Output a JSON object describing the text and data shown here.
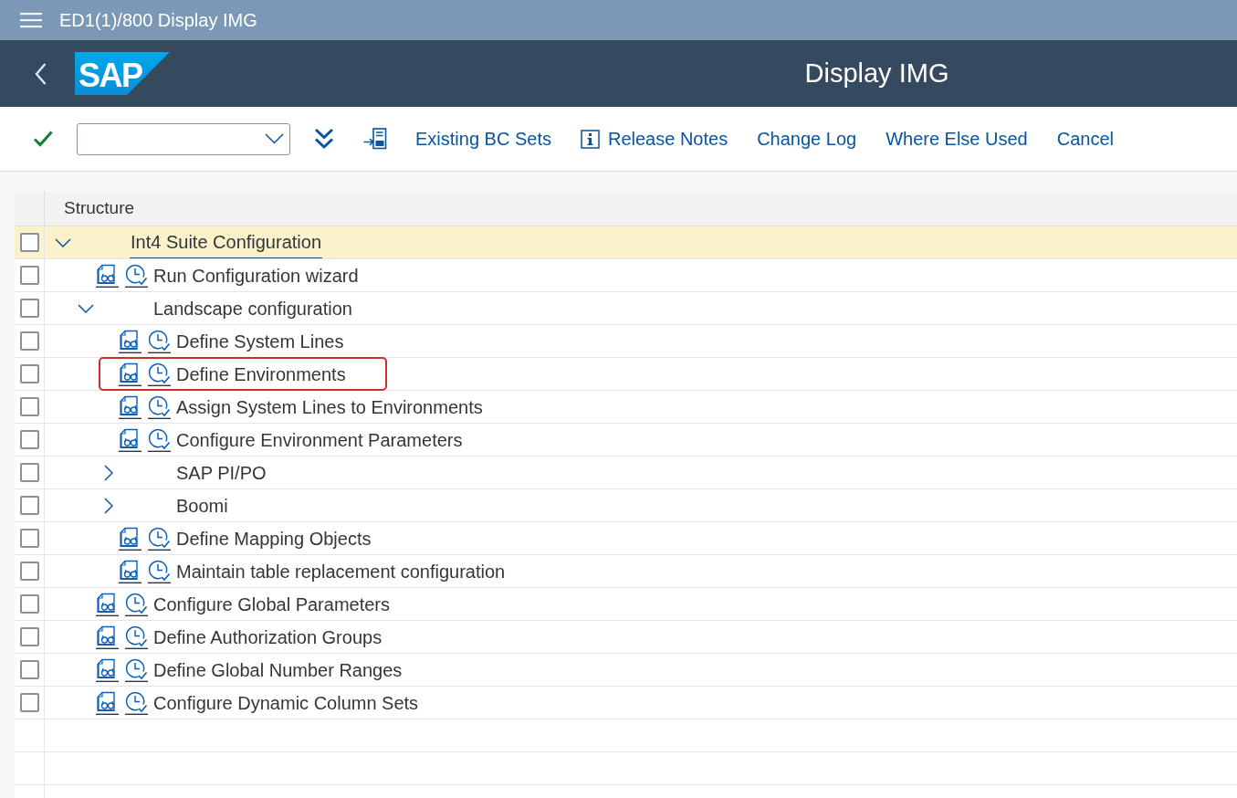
{
  "shell_bar": {
    "title": "ED1(1)/800 Display IMG"
  },
  "header": {
    "logo": "SAP",
    "title": "Display IMG"
  },
  "toolbar": {
    "buttons": [
      {
        "label": "Existing BC Sets",
        "kind": "text"
      },
      {
        "label": "Release Notes",
        "kind": "info"
      },
      {
        "label": "Change Log",
        "kind": "text"
      },
      {
        "label": "Where Else Used",
        "kind": "text"
      },
      {
        "label": "Cancel",
        "kind": "text"
      }
    ]
  },
  "tree": {
    "column": "Structure",
    "items": [
      {
        "label": "Int4 Suite Configuration",
        "kind": "folder",
        "expanded": true,
        "selected": true,
        "checked": false,
        "highlighted": false,
        "children": [
          {
            "label": "Run Configuration wizard",
            "kind": "activity",
            "selected": false,
            "checked": false,
            "highlighted": false
          },
          {
            "label": "Landscape configuration",
            "kind": "folder",
            "expanded": true,
            "selected": false,
            "checked": false,
            "highlighted": false,
            "children": [
              {
                "label": "Define System Lines",
                "kind": "activity",
                "selected": false,
                "checked": false,
                "highlighted": false
              },
              {
                "label": "Define Environments",
                "kind": "activity",
                "selected": false,
                "checked": false,
                "highlighted": true
              },
              {
                "label": "Assign System Lines to Environments",
                "kind": "activity",
                "selected": false,
                "checked": false,
                "highlighted": false
              },
              {
                "label": "Configure Environment Parameters",
                "kind": "activity",
                "selected": false,
                "checked": false,
                "highlighted": false
              },
              {
                "label": "SAP PI/PO",
                "kind": "folder",
                "expanded": false,
                "selected": false,
                "checked": false,
                "highlighted": false
              },
              {
                "label": "Boomi",
                "kind": "folder",
                "expanded": false,
                "selected": false,
                "checked": false,
                "highlighted": false
              },
              {
                "label": "Define Mapping Objects",
                "kind": "activity",
                "selected": false,
                "checked": false,
                "highlighted": false
              },
              {
                "label": "Maintain table replacement configuration",
                "kind": "activity",
                "selected": false,
                "checked": false,
                "highlighted": false
              }
            ]
          },
          {
            "label": "Configure Global Parameters",
            "kind": "activity",
            "selected": false,
            "checked": false,
            "highlighted": false
          },
          {
            "label": "Define Authorization Groups",
            "kind": "activity",
            "selected": false,
            "checked": false,
            "highlighted": false
          },
          {
            "label": "Define Global Number Ranges",
            "kind": "activity",
            "selected": false,
            "checked": false,
            "highlighted": false
          },
          {
            "label": "Configure Dynamic Column Sets",
            "kind": "activity",
            "selected": false,
            "checked": false,
            "highlighted": false
          }
        ]
      }
    ]
  }
}
